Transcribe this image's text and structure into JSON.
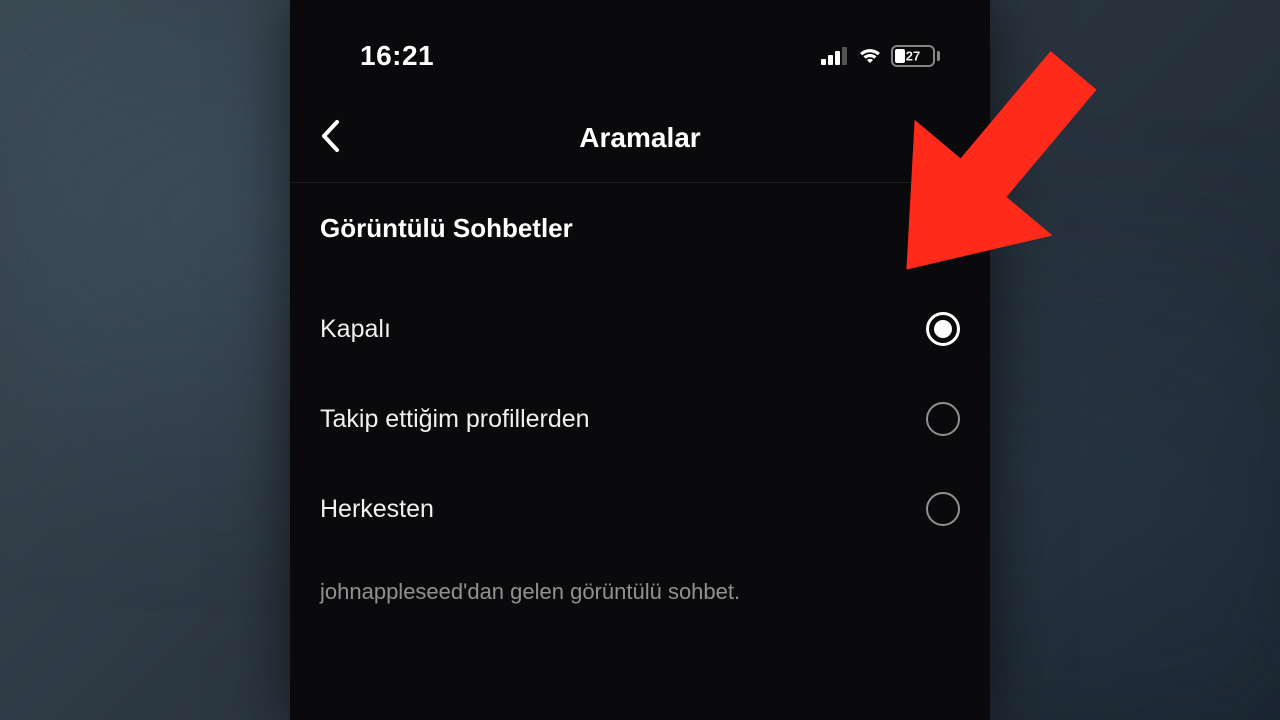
{
  "status_bar": {
    "time": "16:21",
    "battery_percent": "27"
  },
  "header": {
    "title": "Aramalar"
  },
  "section": {
    "title": "Görüntülü Sohbetler",
    "options": [
      {
        "label": "Kapalı",
        "selected": true
      },
      {
        "label": "Takip ettiğim profillerden",
        "selected": false
      },
      {
        "label": "Herkesten",
        "selected": false
      }
    ],
    "footer": "johnappleseed'dan gelen görüntülü sohbet."
  },
  "annotation": {
    "arrow_color": "#ff2a1a"
  }
}
